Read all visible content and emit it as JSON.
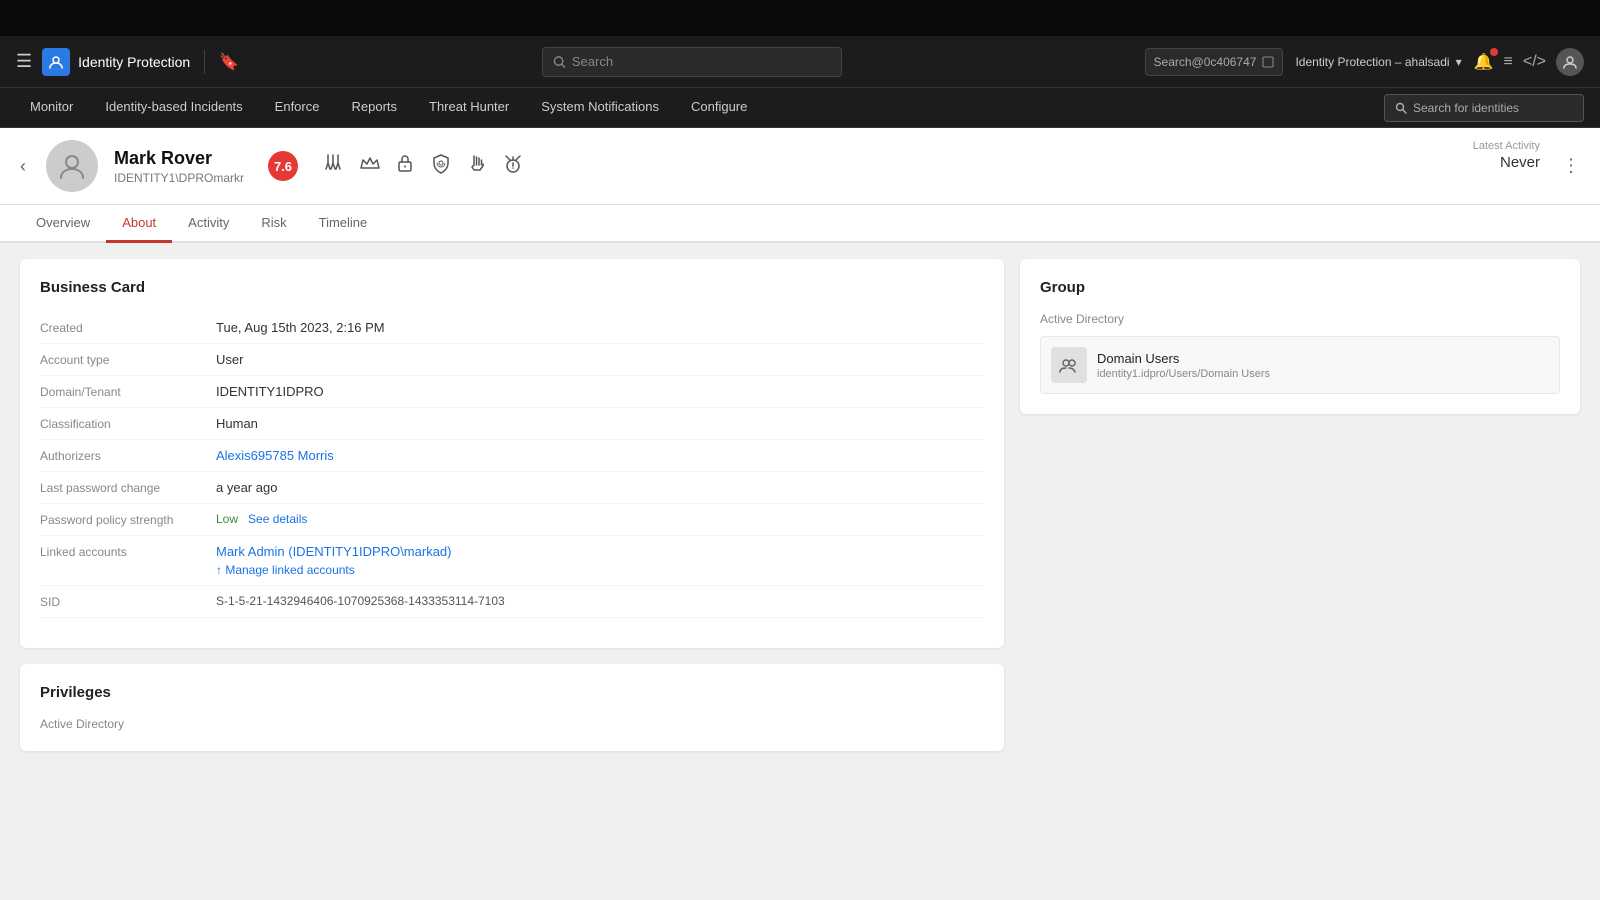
{
  "topBar": {},
  "header": {
    "hamburger": "☰",
    "appName": "Identity Protection",
    "bookmarkIcon": "🔖",
    "searchPlaceholder": "Search",
    "searchContext": "Search@0c406747",
    "appSwitcher": "Identity Protection – ahalsadi",
    "notifIcon": "🔔",
    "menuIcon": "≡",
    "codeIcon": "</>",
    "userIcon": "👤"
  },
  "navbar": {
    "items": [
      {
        "label": "Monitor"
      },
      {
        "label": "Identity-based Incidents"
      },
      {
        "label": "Enforce"
      },
      {
        "label": "Reports"
      },
      {
        "label": "Threat Hunter"
      },
      {
        "label": "System Notifications"
      },
      {
        "label": "Configure"
      }
    ],
    "searchIdentitiesPlaceholder": "Search for identities"
  },
  "identity": {
    "name": "Mark Rover",
    "sub": "IDENTITY1\\DPROmarkr",
    "riskScore": "7.6",
    "latestActivityLabel": "Latest Activity",
    "latestActivityValue": "Never"
  },
  "tabs": [
    {
      "label": "Overview",
      "active": false
    },
    {
      "label": "About",
      "active": true
    },
    {
      "label": "Activity",
      "active": false
    },
    {
      "label": "Risk",
      "active": false
    },
    {
      "label": "Timeline",
      "active": false
    }
  ],
  "businessCard": {
    "title": "Business Card",
    "fields": [
      {
        "label": "Created",
        "value": "Tue, Aug 15th 2023, 2:16 PM",
        "type": "text"
      },
      {
        "label": "Account type",
        "value": "User",
        "type": "text"
      },
      {
        "label": "Domain/Tenant",
        "value": "IDENTITY1IDPRO",
        "type": "text"
      },
      {
        "label": "Classification",
        "value": "Human",
        "type": "text"
      },
      {
        "label": "Authorizers",
        "value": "Alexis695785 Morris",
        "type": "link"
      },
      {
        "label": "Last password change",
        "value": "a year ago",
        "type": "text"
      },
      {
        "label": "Password policy strength",
        "value": "Low",
        "type": "password-policy"
      },
      {
        "label": "Linked accounts",
        "value": "Mark Admin (IDENTITY1IDPRO\\markad)",
        "type": "linked"
      },
      {
        "label": "SID",
        "value": "S-1-5-21-1432946406-1070925368-1433353114-7103",
        "type": "text"
      }
    ]
  },
  "privileges": {
    "title": "Privileges",
    "label": "Active Directory"
  },
  "group": {
    "title": "Group",
    "label": "Active Directory",
    "items": [
      {
        "name": "Domain Users",
        "path": "identity1.idpro/Users/Domain Users"
      }
    ]
  }
}
